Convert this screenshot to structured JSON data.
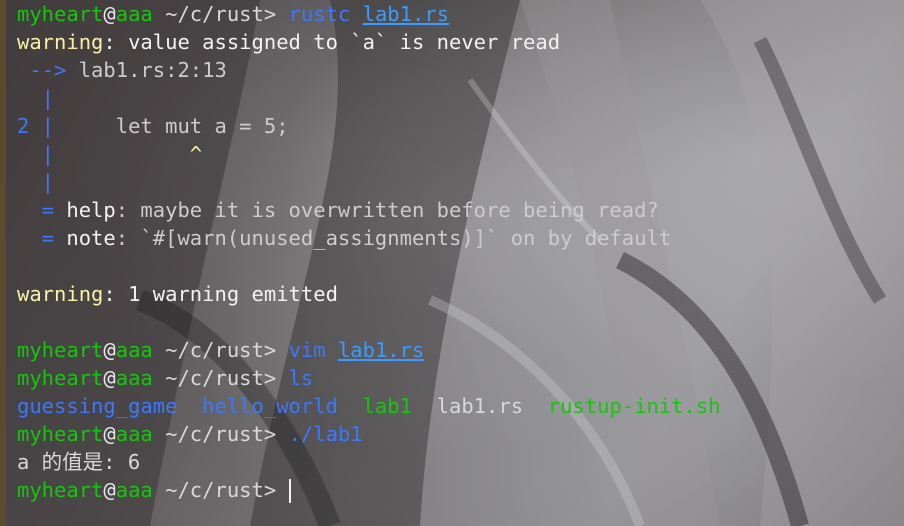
{
  "prompt": {
    "user": "myheart",
    "at": "@",
    "host": "aaa",
    "path": " ~/c/rust",
    "symbol": "> "
  },
  "session": {
    "cmd1": "rustc",
    "cmd1_arg": "lab1.rs",
    "warning_label": "warning",
    "warning_msg": ": value assigned to `a` is never read",
    "arrow": " -->",
    "location": " lab1.rs:2:13",
    "gutter_bar": "  |",
    "line_no": "2",
    "line_bar": " |",
    "code": "     let mut a = 5;",
    "caret_pad": "  |",
    "caret": "           ^",
    "gutter_bar2": "  |",
    "help_eq": "  = ",
    "help_label": "help",
    "help_msg": ": maybe it is overwritten before being read?",
    "note_eq": "  = ",
    "note_label": "note",
    "note_msg": ": `#[warn(unused_assignments)]` on by default",
    "summary_label": "warning",
    "summary_msg": ": 1 warning emitted",
    "cmd2": "vim",
    "cmd2_arg": "lab1.rs",
    "cmd3": "ls",
    "ls_items": [
      {
        "name": "guessing_game",
        "kind": "dir"
      },
      {
        "name": "hello_world",
        "kind": "dir"
      },
      {
        "name": "lab1",
        "kind": "exe"
      },
      {
        "name": "lab1.rs",
        "kind": "file"
      },
      {
        "name": "rustup-init.sh",
        "kind": "exe"
      }
    ],
    "cmd4": "./lab1",
    "output": "a 的值是: 6"
  },
  "colors": {
    "prompt_green": "#16c60c",
    "command_blue": "#3b78ff",
    "warning_yellow": "#f9f1a5",
    "text_gray": "#d8d8d8"
  }
}
